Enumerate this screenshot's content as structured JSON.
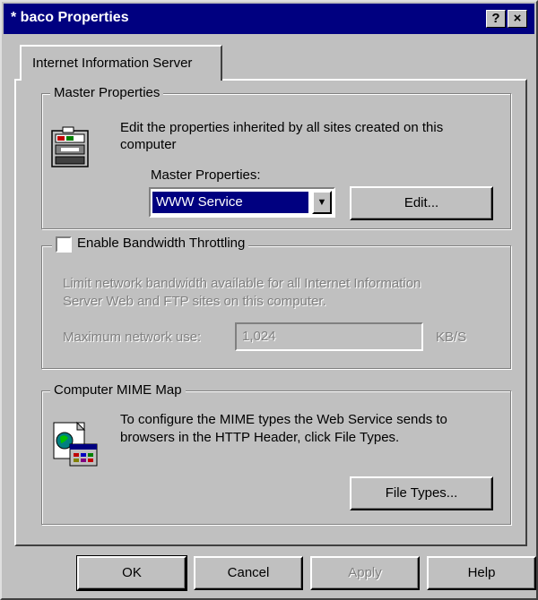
{
  "window": {
    "title": "* baco Properties",
    "help_btn": "?",
    "close_btn": "×"
  },
  "tab": {
    "label": "Internet Information Server"
  },
  "master_props": {
    "group_label": "Master Properties",
    "desc_line1": "Edit the properties inherited by all sites created on this",
    "desc_line2": "computer",
    "select_label": "Master Properties:",
    "select_value": "WWW Service",
    "edit_button": "Edit..."
  },
  "throttle": {
    "checkbox_label": "Enable Bandwidth Throttling",
    "checked": false,
    "desc_line1": "Limit network bandwidth available for all Internet Information",
    "desc_line2": "Server Web and FTP sites on this computer.",
    "max_label": "Maximum network use:",
    "max_value": "1,024",
    "unit": "KB/S"
  },
  "mime": {
    "group_label": "Computer MIME Map",
    "desc_line1": "To configure the MIME types the Web Service sends to",
    "desc_line2": "browsers in the HTTP Header, click File Types.",
    "file_types_button": "File Types..."
  },
  "footer": {
    "ok": "OK",
    "cancel": "Cancel",
    "apply": "Apply",
    "help": "Help"
  },
  "icons": {
    "master": "server-computer-icon",
    "mime": "mime-map-icon",
    "dropdown": "chevron-down-icon"
  }
}
